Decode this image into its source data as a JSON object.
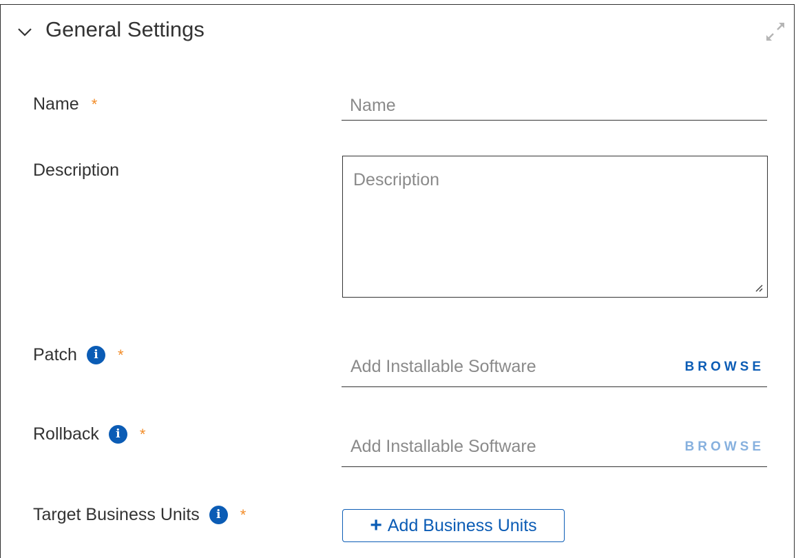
{
  "section": {
    "title": "General Settings",
    "collapse_icon": "chevron-down-icon",
    "expand_icon": "expand-icon"
  },
  "form": {
    "name": {
      "label": "Name",
      "required": "*",
      "placeholder": "Name",
      "value": ""
    },
    "description": {
      "label": "Description",
      "placeholder": "Description",
      "value": ""
    },
    "patch": {
      "label": "Patch",
      "info_glyph": "i",
      "required": "*",
      "placeholder": "Add Installable Software",
      "browse_label": "BROWSE",
      "browse_enabled": true
    },
    "rollback": {
      "label": "Rollback",
      "info_glyph": "i",
      "required": "*",
      "placeholder": "Add Installable Software",
      "browse_label": "BROWSE",
      "browse_enabled": false
    },
    "target_business_units": {
      "label": "Target Business Units",
      "info_glyph": "i",
      "required": "*",
      "add_button_label": "Add Business Units",
      "add_button_icon": "plus-icon"
    }
  },
  "colors": {
    "accent": "#0b5cb5",
    "required": "#f28c28",
    "disabled_accent": "#86b0de"
  }
}
